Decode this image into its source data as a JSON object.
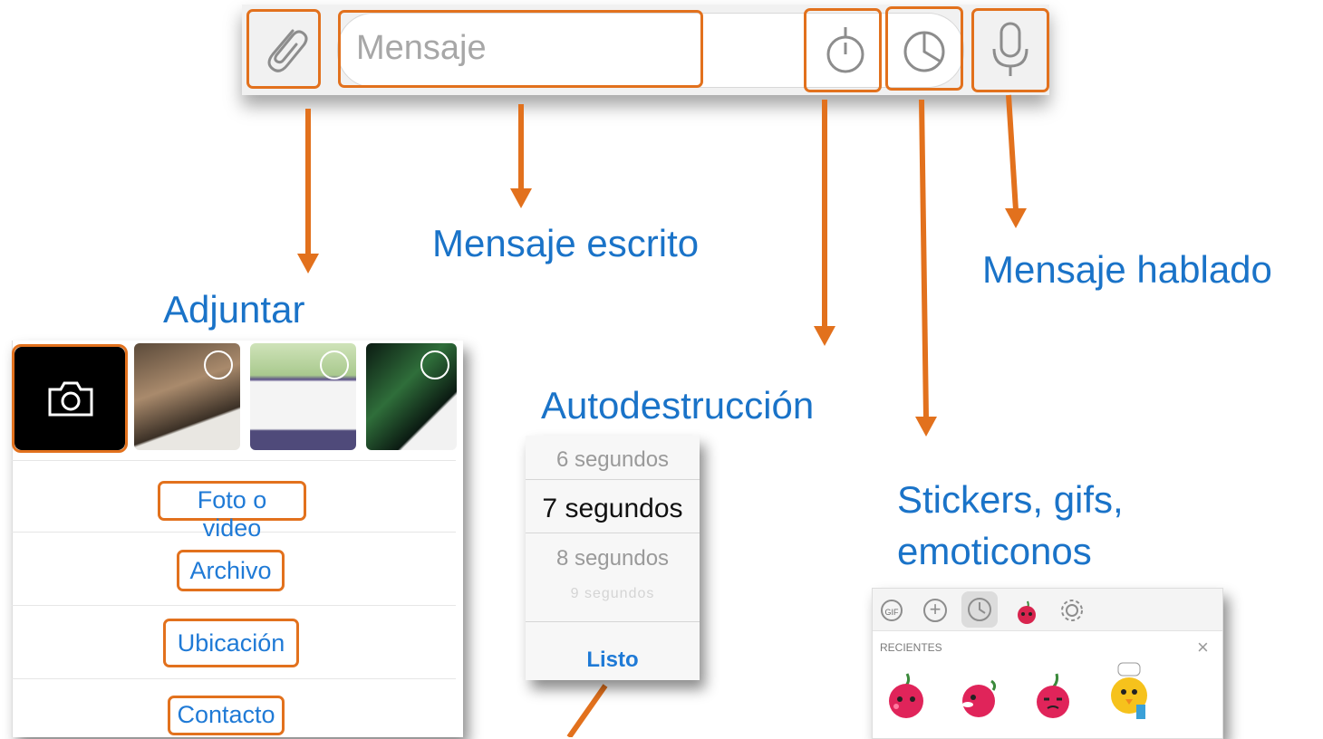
{
  "composer": {
    "placeholder": "Mensaje"
  },
  "labels": {
    "adjuntar": "Adjuntar",
    "mensaje_escrito": "Mensaje escrito",
    "autodestruccion": "Autodestrucción",
    "stickers": [
      "Stickers, gifs,",
      "emoticonos"
    ],
    "mensaje_hablado": "Mensaje hablado"
  },
  "attach_menu": {
    "items": [
      "Foto o video",
      "Archivo",
      "Ubicación",
      "Contacto"
    ]
  },
  "timer_picker": {
    "options": [
      "6 segundos",
      "7 segundos",
      "8 segundos",
      "9 segundos"
    ],
    "selected": "7 segundos",
    "done_label": "Listo"
  },
  "stickers_panel": {
    "section_title": "RECIENTES",
    "tab_icons": [
      "gif-icon",
      "add-icon",
      "recent-clock-icon",
      "cherry-sticker-icon",
      "settings-icon"
    ]
  },
  "colors": {
    "highlight": "#e2711d",
    "label_text": "#1a73c8",
    "link": "#1f7ad6"
  }
}
